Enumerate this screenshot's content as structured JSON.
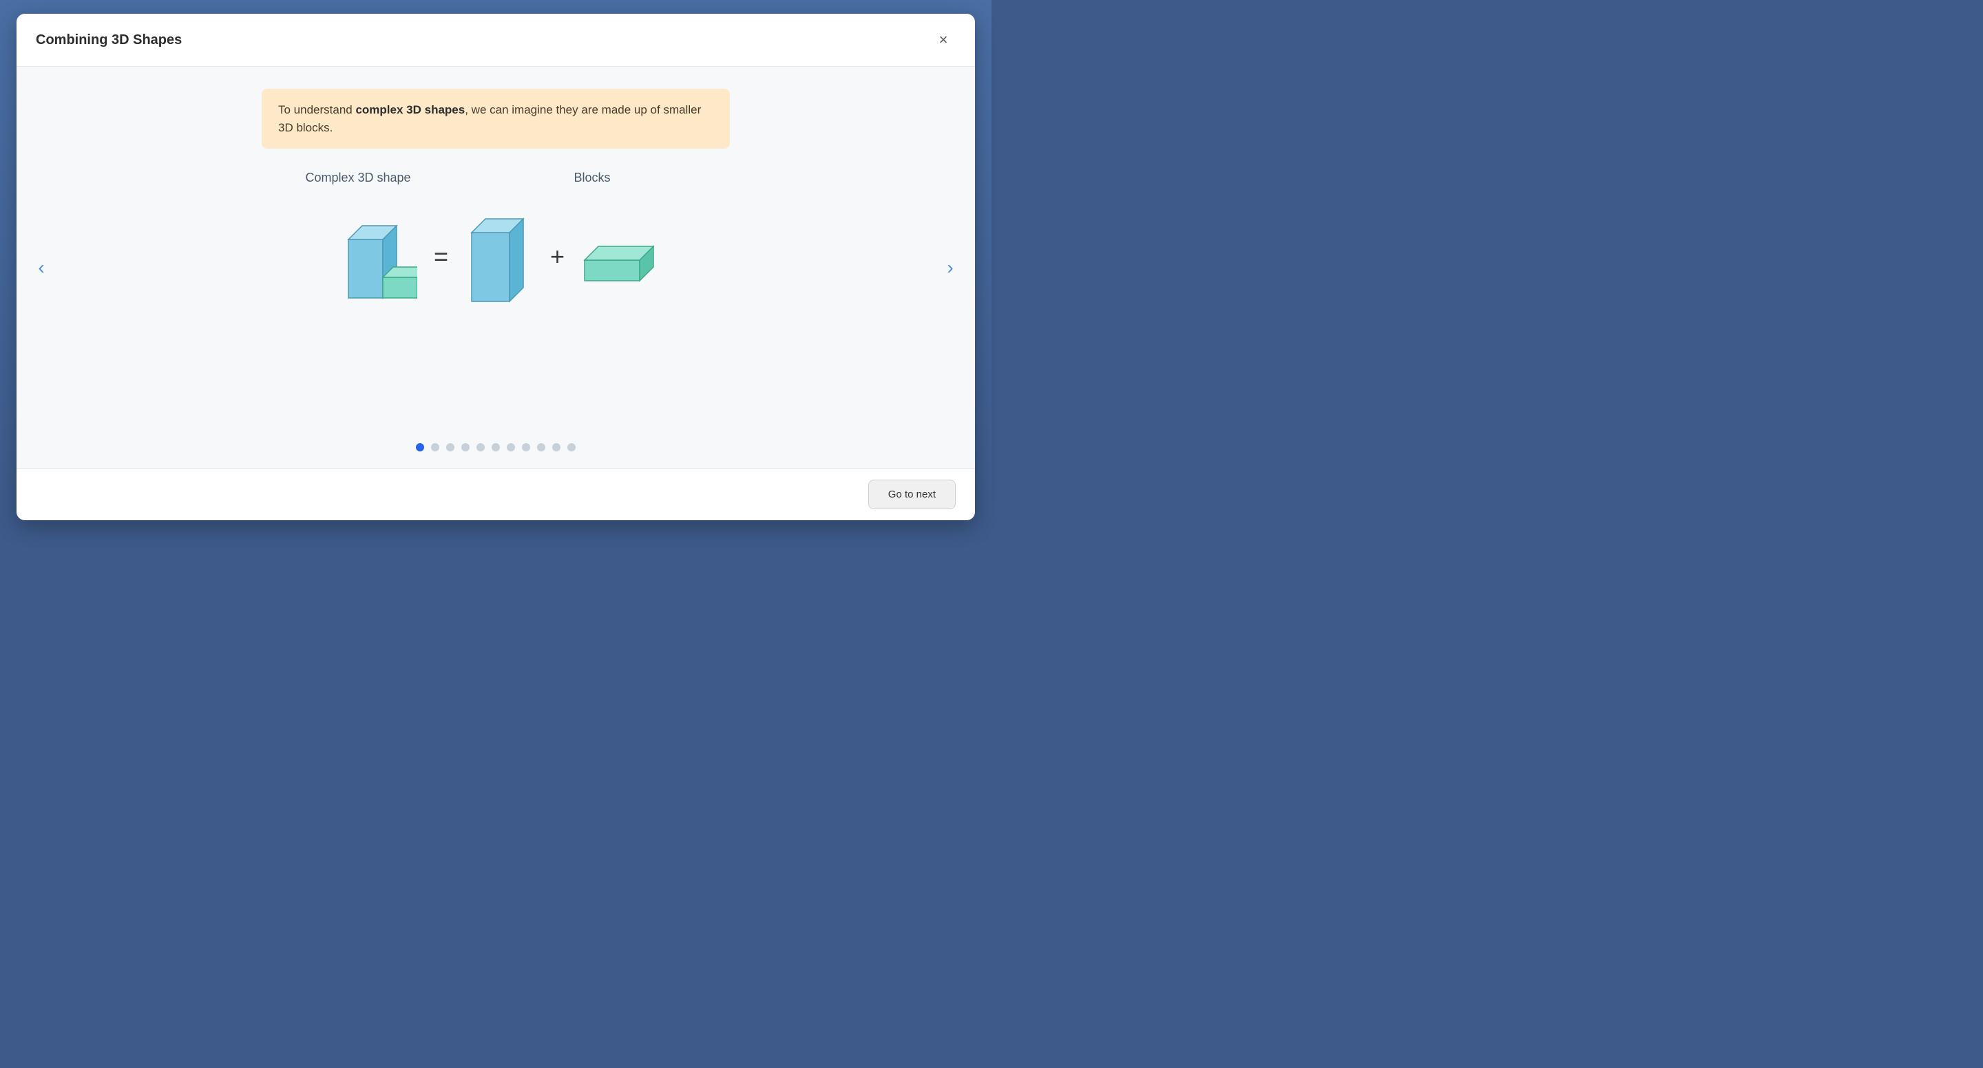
{
  "header": {
    "title": "Combining 3D Shapes",
    "close_label": "×"
  },
  "info_box": {
    "text_before": "To understand ",
    "text_bold": "complex 3D shapes",
    "text_after": ", we can imagine they are made up of smaller 3D blocks."
  },
  "diagram": {
    "label_left": "Complex 3D shape",
    "label_right": "Blocks",
    "eq_sign": "=",
    "plus_sign": "+"
  },
  "pagination": {
    "total": 11,
    "active_index": 0
  },
  "footer": {
    "go_next_label": "Go to next"
  },
  "nav": {
    "left_arrow": "‹",
    "right_arrow": "›"
  }
}
